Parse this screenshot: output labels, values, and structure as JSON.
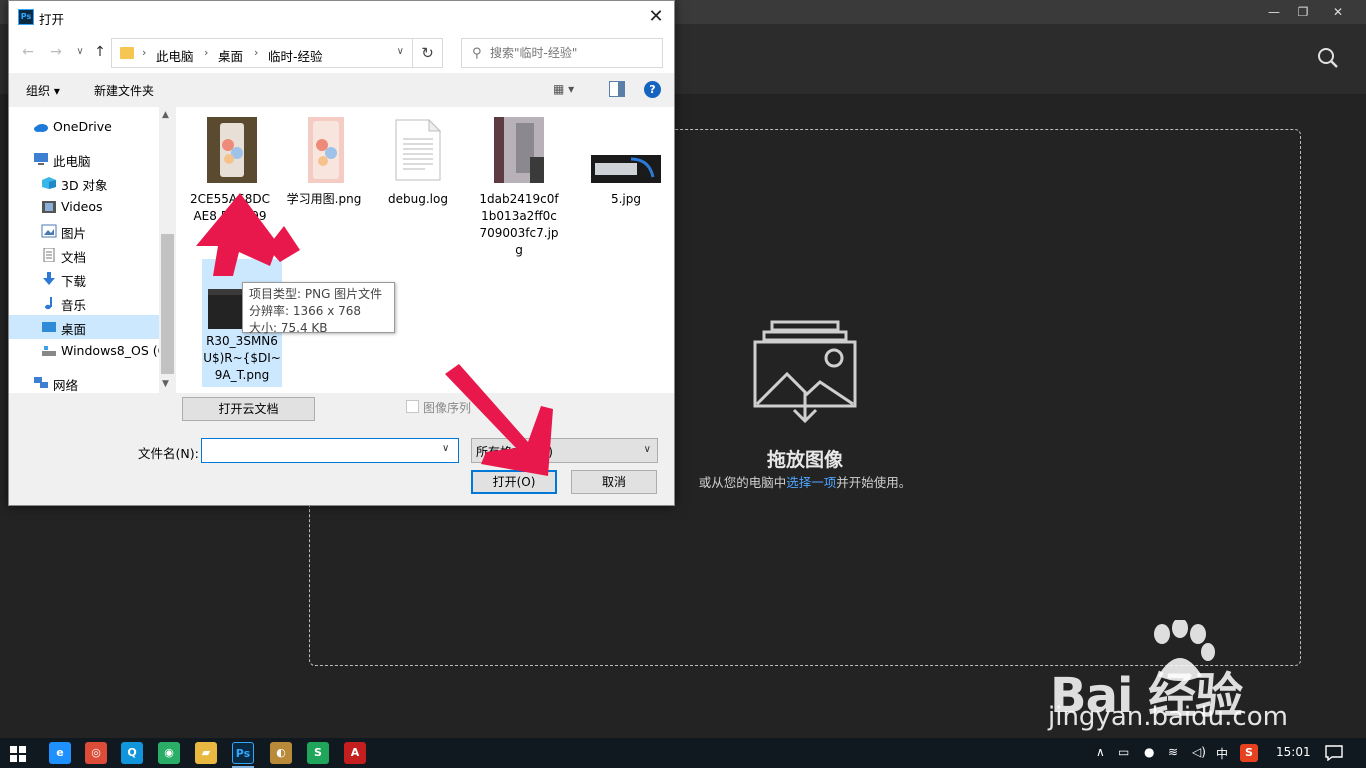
{
  "dialog": {
    "title": "打开",
    "app_logo": "Ps",
    "breadcrumb": [
      "此电脑",
      "桌面",
      "临时-经验"
    ],
    "search_placeholder": "搜索\"临时-经验\"",
    "toolbar": {
      "organize": "组织 ▾",
      "new_folder": "新建文件夹"
    },
    "nav_items": [
      {
        "label": "OneDrive",
        "icon": "cloud-icon"
      },
      {
        "label": "此电脑",
        "icon": "computer-icon"
      },
      {
        "label": "3D 对象",
        "icon": "cube-icon"
      },
      {
        "label": "Videos",
        "icon": "film-icon"
      },
      {
        "label": "图片",
        "icon": "picture-icon"
      },
      {
        "label": "文档",
        "icon": "document-icon"
      },
      {
        "label": "下载",
        "icon": "download-icon"
      },
      {
        "label": "音乐",
        "icon": "music-icon"
      },
      {
        "label": "桌面",
        "icon": "desktop-icon",
        "selected": true
      },
      {
        "label": "Windows8_OS (C",
        "icon": "drive-icon"
      },
      {
        "label": "网络",
        "icon": "network-icon"
      }
    ],
    "files": [
      {
        "name": "2CE55A68DCAE8 5 96 99 g",
        "icon": "image-thumb-phone"
      },
      {
        "name": "学习用图.png",
        "icon": "image-thumb-phone-pink"
      },
      {
        "name": "debug.log",
        "icon": "text-file-icon"
      },
      {
        "name": "1dab2419c0f1b013a2ff0c709003fc7.jpg",
        "icon": "image-thumb-photo"
      },
      {
        "name": "5.jpg",
        "icon": "image-thumb-dark"
      },
      {
        "name": "R30_3SMN6U$)R~{$DI~9A_T.png",
        "icon": "image-thumb-screenshot",
        "selected": true
      }
    ],
    "tooltip": {
      "type": "项目类型: PNG 图片文件",
      "dimensions": "分辨率: 1366 x 768",
      "size": "大小: 75.4 KB"
    },
    "cloud_button": "打开云文档",
    "image_sequence_label": "图像序列",
    "filename_label": "文件名(N):",
    "filename_value": "",
    "filetype_value": "所有格式 (*.*)",
    "open_button": "打开(O)",
    "cancel_button": "取消"
  },
  "photoshop": {
    "drop_title": "拖放图像",
    "drop_sub_before": "或从您的电脑中",
    "drop_sub_link": "选择一项",
    "drop_sub_after": "并开始使用。"
  },
  "watermark": {
    "brand": "Bai 经验",
    "url": "jingyan.baidu.com"
  },
  "taskbar": {
    "apps": [
      {
        "name": "ie-icon",
        "glyph": "e",
        "color": "#1e90ff"
      },
      {
        "name": "chrome-icon",
        "glyph": "◎",
        "color": "#dd4b39"
      },
      {
        "name": "qq-browser-icon",
        "glyph": "Q",
        "color": "#1296db"
      },
      {
        "name": "wechat-icon",
        "glyph": "◉",
        "color": "#2aae67"
      },
      {
        "name": "file-explorer-icon",
        "glyph": "▰",
        "color": "#e9b840"
      },
      {
        "name": "photoshop-icon",
        "glyph": "Ps",
        "color": "#0a2a44"
      },
      {
        "name": "pinball-icon",
        "glyph": "◐",
        "color": "#b88a3a"
      },
      {
        "name": "wps-spreadsheet-icon",
        "glyph": "S",
        "color": "#20a65a"
      },
      {
        "name": "acrobat-icon",
        "glyph": "A",
        "color": "#c41e1e"
      }
    ],
    "ime": "中",
    "clock": "15:01"
  }
}
